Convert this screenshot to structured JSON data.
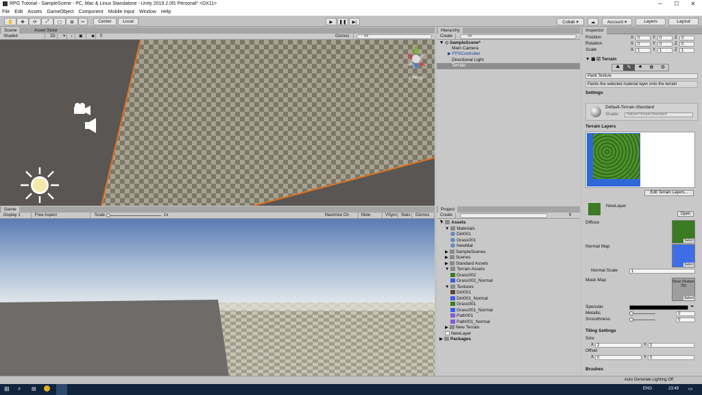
{
  "window": {
    "title": "RPG Tutorial - SampleScene - PC, Mac & Linux Standalone - Unity 2019.2.0f1 Personal* <DX11>",
    "min": "─",
    "max": "☐",
    "close": "✕"
  },
  "menu": [
    "File",
    "Edit",
    "Assets",
    "GameObject",
    "Component",
    "Mobile Input",
    "Window",
    "Help"
  ],
  "toolbar": {
    "pivot": "Center",
    "space": "Local",
    "collab": "Collab ▾",
    "account": "Account ▾",
    "layers": "Layers",
    "layout": "Layout"
  },
  "scene_panel": {
    "tab_scene": "Scene",
    "tab_asset_store": "Asset Store",
    "shading": "Shaded",
    "mode_2d": "2D",
    "fx_count": "0",
    "gizmos": "Gizmos ▾",
    "search_placeholder": "All",
    "persp": "< Persp"
  },
  "game_panel": {
    "tab": "Game",
    "display": "Display 1",
    "aspect": "Free Aspect",
    "scale_label": "Scale",
    "scale_value": "1x",
    "maximize": "Maximize On Play",
    "mute": "Mute Audio",
    "vsync": "VSync",
    "stats": "Stats",
    "gizmos": "Gizmos ▾"
  },
  "hierarchy": {
    "tab": "Hierarchy",
    "create": "Create ▾",
    "search_placeholder": "All",
    "scene": "SampleScene*",
    "items": [
      "Main Camera",
      "FPSController",
      "Directional Light",
      "Terrain"
    ]
  },
  "project": {
    "tab": "Project",
    "create": "Create ▾",
    "count": "9",
    "tree": [
      {
        "label": "Assets",
        "level": 0,
        "kind": "folder-open"
      },
      {
        "label": "Materials",
        "level": 1,
        "kind": "folder-open"
      },
      {
        "label": "Dirt001",
        "level": 2,
        "kind": "material"
      },
      {
        "label": "Grass001",
        "level": 2,
        "kind": "material"
      },
      {
        "label": "NewMat",
        "level": 2,
        "kind": "material"
      },
      {
        "label": "SampleScenes",
        "level": 1,
        "kind": "folder"
      },
      {
        "label": "Scenes",
        "level": 1,
        "kind": "folder"
      },
      {
        "label": "Standard Assets",
        "level": 1,
        "kind": "folder"
      },
      {
        "label": "Terrain Assets",
        "level": 1,
        "kind": "folder-open"
      },
      {
        "label": "Grass002",
        "level": 2,
        "kind": "tex-green"
      },
      {
        "label": "Grass002_Normal",
        "level": 2,
        "kind": "tex-blue"
      },
      {
        "label": "Textures",
        "level": 1,
        "kind": "folder-open"
      },
      {
        "label": "Dirt001",
        "level": 2,
        "kind": "tex-brown"
      },
      {
        "label": "Dirt001_Normal",
        "level": 2,
        "kind": "tex-blue"
      },
      {
        "label": "Grass001",
        "level": 2,
        "kind": "tex-green"
      },
      {
        "label": "Grass001_Normal",
        "level": 2,
        "kind": "tex-blue"
      },
      {
        "label": "Path001",
        "level": 2,
        "kind": "tex-purple"
      },
      {
        "label": "Path001_Normal",
        "level": 2,
        "kind": "tex-purple"
      },
      {
        "label": "New Terrain",
        "level": 1,
        "kind": "folder"
      },
      {
        "label": "NewLayer",
        "level": 1,
        "kind": "file"
      },
      {
        "label": "Packages",
        "level": 0,
        "kind": "folder"
      }
    ]
  },
  "inspector": {
    "tab": "Inspector",
    "transform": {
      "position": "Position",
      "rotation": "Rotation",
      "scale": "Scale",
      "x": "X",
      "y": "Y",
      "z": "Z",
      "pos": [
        "0",
        "0",
        "0"
      ],
      "rot": [
        "0",
        "0",
        "0"
      ],
      "scl": [
        "1",
        "1",
        "1"
      ]
    },
    "component": "Terrain",
    "tool_dropdown": "Paint Texture",
    "help_text": "Paints the selected material layer onto the terrain",
    "settings": "Settings",
    "material_name": "Default-Terrain-Standard",
    "shader_label": "Shader",
    "shader_value": "Nature/Terrain/Standard",
    "terrain_layers": "Terrain Layers",
    "edit_layers": "Edit Terrain Layers...",
    "layer_name": "NewLayer",
    "open": "Open",
    "diffuse": "Diffuse",
    "normal_map": "Normal Map",
    "normal_scale": "Normal Scale",
    "normal_scale_value": "1",
    "mask_map": "Mask Map",
    "mask_none": "None (Texture 2D)",
    "select": "Select",
    "specular": "Specular",
    "metallic": "Metallic",
    "metallic_value": "0",
    "smoothness": "Smoothness",
    "smoothness_value": "0",
    "tiling": "Tiling Settings",
    "size": "Size",
    "size_x": "2",
    "size_y": "2",
    "offset": "Offset",
    "offset_x": "0",
    "offset_y": "0",
    "brushes": "Brushes"
  },
  "status": {
    "right": "Auto Generate Lighting Off"
  },
  "taskbar": {
    "lang": "ENG",
    "time": "23:49"
  }
}
